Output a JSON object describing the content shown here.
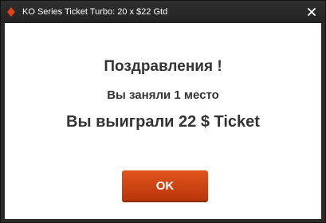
{
  "window": {
    "title": "KO Series Ticket Turbo: 20 x $22 Gtd",
    "app_icon": "diamond-suit-icon",
    "close_icon": "close-icon"
  },
  "dialog": {
    "heading": "Поздравления !",
    "place_text": "Вы заняли 1 место",
    "prize_text": "Вы выиграли 22 $ Ticket",
    "ok_label": "OK"
  },
  "colors": {
    "titlebar": "#2a2a2a",
    "accent": "#d24a17",
    "text": "#333333"
  }
}
